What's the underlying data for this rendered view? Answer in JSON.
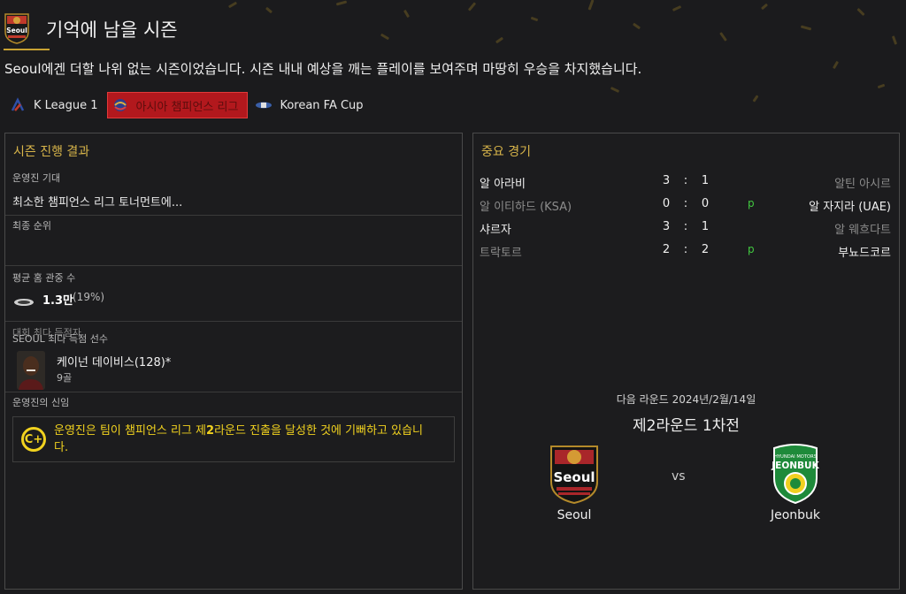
{
  "header": {
    "title": "기억에 남을 시즌",
    "subtitle": "Seoul에겐 더할 나위 없는 시즌이었습니다. 시즌 내내 예상을 깨는 플레이를 보여주며 마땅히 우승을 차지했습니다.",
    "club_logo_text": "Seoul"
  },
  "tabs": [
    {
      "label": "K League 1",
      "icon": "k-league-icon",
      "active": false
    },
    {
      "label": "아시아 챔피언스 리그",
      "icon": "acl-icon",
      "active": true
    },
    {
      "label": "Korean FA Cup",
      "icon": "fa-cup-icon",
      "active": false
    }
  ],
  "season_panel": {
    "title": "시즌 진행 결과",
    "expectation_label": "운영진 기대",
    "expectation_value": "최소한 챔피언스 리그 토너먼트에...",
    "final_rank_label": "최종 순위",
    "attendance_label": "평균 홈 관중 수",
    "attendance_value": "1.3만",
    "attendance_pct": "(19%)",
    "top_scorer_label_back": "대회 최다 득점자",
    "top_scorer_label_front": "SEOUL 최다 득점 선수",
    "top_scorer_name": "케이넌 데이비스(128)*",
    "top_scorer_goals": "9골",
    "board_label": "운영진의 신임",
    "board_icon_text": "C+",
    "board_text_part1": "운영진은 팀이 챔피언스 리그 제",
    "board_text_bold": "2",
    "board_text_part2": "라운드 진출을 달성한 것에 기뻐하고 있습니다."
  },
  "matches_panel": {
    "title": "중요 경기",
    "matches": [
      {
        "home": "알 아라비",
        "home_score": "3",
        "away_score": "1",
        "penalty": "",
        "away": "알틴 아시르",
        "highlight": "home"
      },
      {
        "home": "알 이티하드 (KSA)",
        "home_score": "0",
        "away_score": "0",
        "penalty": "p",
        "away": "알 자지라 (UAE)",
        "highlight": "away"
      },
      {
        "home": "샤르자",
        "home_score": "3",
        "away_score": "1",
        "penalty": "",
        "away": "알 웨흐다트",
        "highlight": "home"
      },
      {
        "home": "트락토르",
        "home_score": "2",
        "away_score": "2",
        "penalty": "p",
        "away": "부뇨드코르",
        "highlight": "away"
      }
    ],
    "colon": ":",
    "next_round": "다음 라운드 2024년/2월/14일",
    "next_stage": "제2라운드 1차전",
    "home_team": "Seoul",
    "away_team": "Jeonbuk",
    "vs": "vs",
    "away_crest_top_text": "HYUNDAI MOTORS",
    "away_crest_text": "JEONBUK"
  },
  "colors": {
    "accent_gold": "#d8b54a",
    "active_tab_red": "#b2181d",
    "board_yellow": "#f1d21f",
    "penalty_green": "#41c940"
  }
}
